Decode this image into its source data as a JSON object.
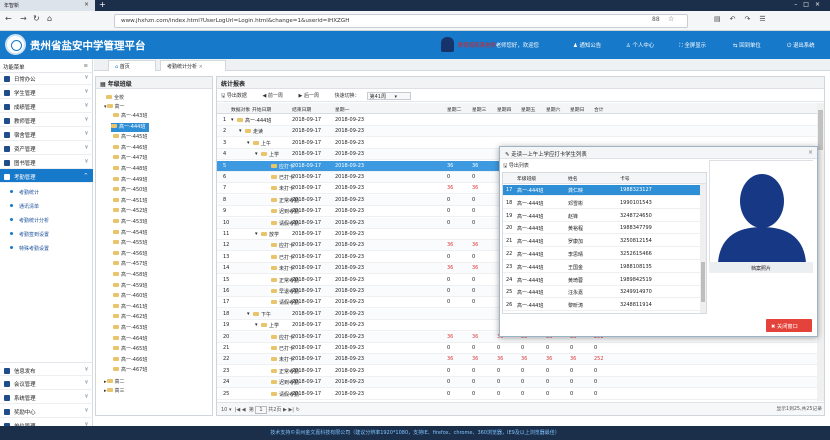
{
  "browser": {
    "tab_title": "年智新",
    "url": "www.jhxhzn.com/index.html?UserLogUrl=Login.html&change=1&userid=IHXZGH",
    "ext_label": "88"
  },
  "header": {
    "title": "贵州省盐安中学管理平台",
    "user_name": "教育局某某老师",
    "welcome": "老师您好，欢迎您",
    "buttons": [
      "通知公告",
      "个人中心",
      "全屏显示",
      "回到单位",
      "退出系统"
    ]
  },
  "menu": {
    "title": "功能菜单",
    "items_top": [
      "日常办公",
      "学生管理",
      "成绩管理",
      "教师管理",
      "宿舍管理",
      "资产管理",
      "图书管理",
      "考勤管理"
    ],
    "sub_items": [
      "考勤统计",
      "通讯清单",
      "考勤统计分析",
      "考勤签到设置",
      "特殊考勤设置"
    ],
    "items_bottom": [
      "信息发布",
      "会议管理",
      "系统管理",
      "奖励中心",
      "单位管理"
    ]
  },
  "content_tabs": [
    "首页",
    "考勤统计分析"
  ],
  "tree": {
    "title": "年级班级",
    "root": "全校",
    "grade": "高一",
    "classes": [
      "高一-443班",
      "高一-444班",
      "高一-445班",
      "高一-446班",
      "高一-447班",
      "高一-448班",
      "高一-449班",
      "高一-450班",
      "高一-451班",
      "高一-452班",
      "高一-453班",
      "高一-454班",
      "高一-455班",
      "高一-456班",
      "高一-457班",
      "高一-458班",
      "高一-459班",
      "高一-460班",
      "高一-461班",
      "高一-462班",
      "高一-463班",
      "高一-464班",
      "高一-465班",
      "高一-466班",
      "高一-467班"
    ],
    "other_grades": [
      "高二",
      "高三"
    ]
  },
  "stats": {
    "title": "统计报表",
    "toolbar": [
      "导出数据",
      "前一周",
      "后一周"
    ],
    "quick_label": "快速切换：",
    "quick_value": "第41周",
    "columns": [
      "数据对象",
      "开始日期",
      "结束日期",
      "星期一",
      "星期二",
      "星期三",
      "星期四",
      "星期五",
      "星期六",
      "星期日",
      "合计"
    ],
    "rows": [
      {
        "n": "1",
        "name": "高一-444班",
        "s": "2018-09-17",
        "e": "2018-09-23",
        "v": [
          "",
          "",
          "",
          "",
          "",
          "",
          ""
        ]
      },
      {
        "n": "2",
        "name": "走读",
        "s": "2018-09-17",
        "e": "2018-09-23",
        "v": [
          "",
          "",
          "",
          "",
          "",
          "",
          ""
        ]
      },
      {
        "n": "3",
        "name": "上午",
        "s": "2018-09-17",
        "e": "2018-09-23",
        "v": [
          "",
          "",
          "",
          "",
          "",
          "",
          ""
        ]
      },
      {
        "n": "4",
        "name": "上学",
        "s": "2018-09-17",
        "e": "2018-09-23",
        "v": [
          "",
          "",
          "",
          "",
          "",
          "",
          ""
        ]
      },
      {
        "n": "5",
        "name": "应打卡",
        "s": "2018-09-17",
        "e": "2018-09-23",
        "v": [
          "36",
          "36",
          "",
          "",
          "",
          "",
          ""
        ]
      },
      {
        "n": "6",
        "name": "已打卡",
        "s": "2018-09-17",
        "e": "2018-09-23",
        "v": [
          "0",
          "0",
          "",
          "",
          "",
          "",
          ""
        ]
      },
      {
        "n": "7",
        "name": "未打卡",
        "s": "2018-09-17",
        "e": "2018-09-23",
        "v": [
          "36",
          "36",
          "",
          "",
          "",
          "",
          ""
        ]
      },
      {
        "n": "8",
        "name": "正常考勤",
        "s": "2018-09-17",
        "e": "2018-09-23",
        "v": [
          "0",
          "0",
          "",
          "",
          "",
          "",
          ""
        ]
      },
      {
        "n": "9",
        "name": "迟到考勤",
        "s": "2018-09-17",
        "e": "2018-09-23",
        "v": [
          "0",
          "0",
          "",
          "",
          "",
          "",
          ""
        ]
      },
      {
        "n": "10",
        "name": "请假考勤",
        "s": "2018-09-17",
        "e": "2018-09-23",
        "v": [
          "0",
          "0",
          "",
          "",
          "",
          "",
          ""
        ]
      },
      {
        "n": "11",
        "name": "放学",
        "s": "2018-09-17",
        "e": "2018-09-23",
        "v": [
          "",
          "",
          "",
          "",
          "",
          "",
          ""
        ]
      },
      {
        "n": "12",
        "name": "应打卡",
        "s": "2018-09-17",
        "e": "2018-09-23",
        "v": [
          "36",
          "36",
          "",
          "",
          "",
          "",
          ""
        ]
      },
      {
        "n": "13",
        "name": "已打卡",
        "s": "2018-09-17",
        "e": "2018-09-23",
        "v": [
          "0",
          "0",
          "",
          "",
          "",
          "",
          ""
        ]
      },
      {
        "n": "14",
        "name": "未打卡",
        "s": "2018-09-17",
        "e": "2018-09-23",
        "v": [
          "36",
          "36",
          "",
          "",
          "",
          "",
          ""
        ]
      },
      {
        "n": "15",
        "name": "正常考勤",
        "s": "2018-09-17",
        "e": "2018-09-23",
        "v": [
          "0",
          "0",
          "",
          "",
          "",
          "",
          ""
        ]
      },
      {
        "n": "16",
        "name": "早退考勤",
        "s": "2018-09-17",
        "e": "2018-09-23",
        "v": [
          "0",
          "0",
          "",
          "",
          "",
          "",
          ""
        ]
      },
      {
        "n": "17",
        "name": "请假考勤",
        "s": "2018-09-17",
        "e": "2018-09-23",
        "v": [
          "0",
          "0",
          "",
          "",
          "",
          "",
          ""
        ]
      },
      {
        "n": "18",
        "name": "下午",
        "s": "2018-09-17",
        "e": "2018-09-23",
        "v": [
          "",
          "",
          "",
          "",
          "",
          "",
          ""
        ]
      },
      {
        "n": "19",
        "name": "上学",
        "s": "2018-09-17",
        "e": "2018-09-23",
        "v": [
          "",
          "",
          "",
          "",
          "",
          "",
          ""
        ]
      },
      {
        "n": "20",
        "name": "应打卡",
        "s": "2018-09-17",
        "e": "2018-09-23",
        "v": [
          "36",
          "36",
          "36",
          "36",
          "36",
          "36",
          "252"
        ]
      },
      {
        "n": "21",
        "name": "已打卡",
        "s": "2018-09-17",
        "e": "2018-09-23",
        "v": [
          "0",
          "0",
          "0",
          "0",
          "0",
          "0",
          "0"
        ]
      },
      {
        "n": "22",
        "name": "未打卡",
        "s": "2018-09-17",
        "e": "2018-09-23",
        "v": [
          "36",
          "36",
          "36",
          "36",
          "36",
          "36",
          "252"
        ]
      },
      {
        "n": "23",
        "name": "正常考勤",
        "s": "2018-09-17",
        "e": "2018-09-23",
        "v": [
          "0",
          "0",
          "0",
          "0",
          "0",
          "0",
          "0"
        ]
      },
      {
        "n": "24",
        "name": "迟到考勤",
        "s": "2018-09-17",
        "e": "2018-09-23",
        "v": [
          "0",
          "0",
          "0",
          "0",
          "0",
          "0",
          "0"
        ]
      },
      {
        "n": "25",
        "name": "请假考勤",
        "s": "2018-09-17",
        "e": "2018-09-23",
        "v": [
          "0",
          "0",
          "0",
          "0",
          "0",
          "0",
          "0"
        ]
      }
    ],
    "pager": {
      "page": "1",
      "of": "共2页",
      "info": "显示1到25,共25记录"
    }
  },
  "modal": {
    "title": "走读—上午上学应打卡学生列表",
    "toolbar": "导出列表",
    "columns": [
      "年级班级",
      "姓名",
      "卡号"
    ],
    "rows": [
      {
        "n": "17",
        "c": "高一-444班",
        "name": "龚仁映",
        "card": "1988323127"
      },
      {
        "n": "18",
        "c": "高一-444班",
        "name": "邓雪彬",
        "card": "1990101543"
      },
      {
        "n": "19",
        "c": "高一-444班",
        "name": "赵锋",
        "card": "3248724650"
      },
      {
        "n": "20",
        "c": "高一-444班",
        "name": "黄裕程",
        "card": "1988347799"
      },
      {
        "n": "21",
        "c": "高一-444班",
        "name": "罗康加",
        "card": "3250812154"
      },
      {
        "n": "22",
        "c": "高一-444班",
        "name": "李思晴",
        "card": "3252615466"
      },
      {
        "n": "23",
        "c": "高一-444班",
        "name": "王国金",
        "card": "1988108135"
      },
      {
        "n": "24",
        "c": "高一-444班",
        "name": "黄琦蓉",
        "card": "1989842519"
      },
      {
        "n": "25",
        "c": "高一-444班",
        "name": "汪永嘉",
        "card": "3249914970"
      },
      {
        "n": "26",
        "c": "高一-444班",
        "name": "黎昕涛",
        "card": "3248811914"
      }
    ],
    "photo_caption": "档案照片",
    "close_label": "关闭窗口"
  },
  "footer": "技术支持©贵州金文嘉科技有限公司（建议分辨率1920*1080，支持IE、firefox、chrome、360浏览器，IE9及以上浏览器最佳）"
}
